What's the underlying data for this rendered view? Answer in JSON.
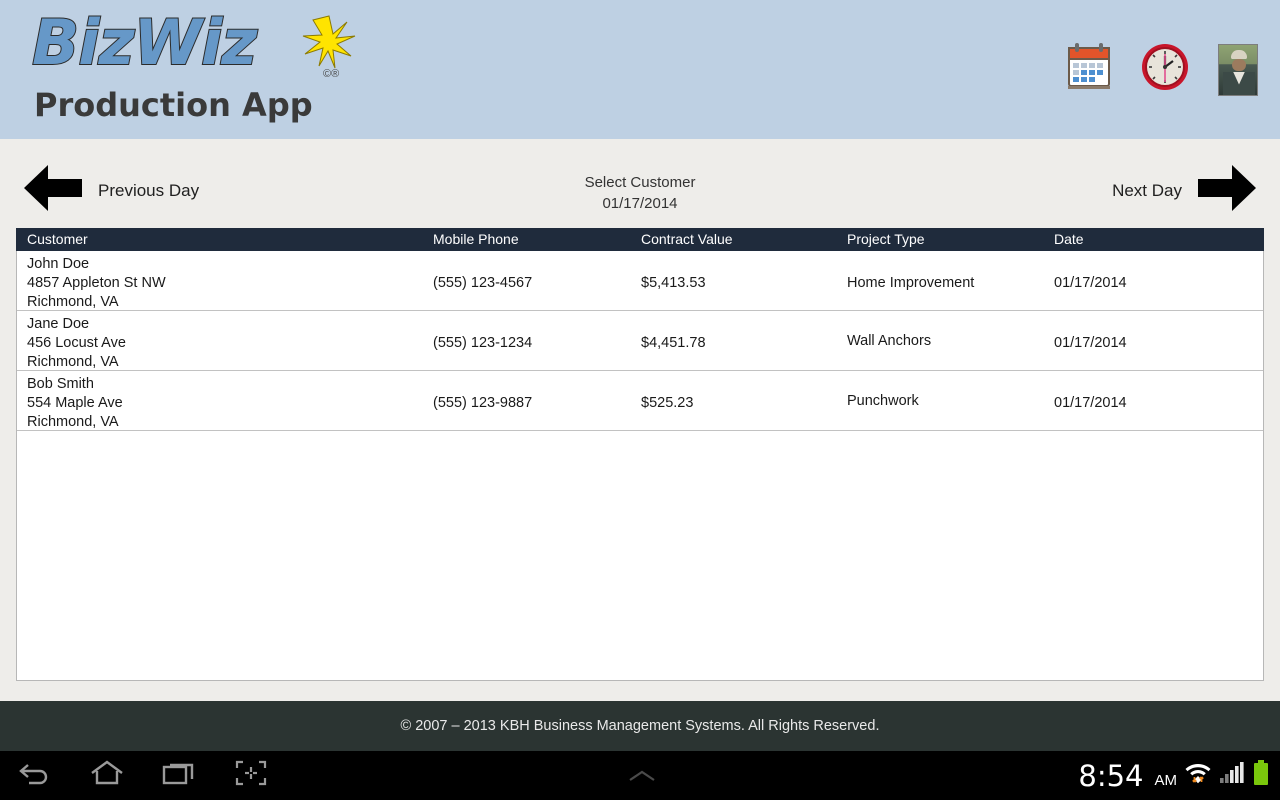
{
  "app": {
    "logo_main": "BizWiz",
    "logo_copyright": "©®",
    "logo_sub": "Production App",
    "header_bg": "#bed0e3",
    "icons": [
      {
        "name": "calendar-icon",
        "label": "Calendar"
      },
      {
        "name": "clock-icon",
        "label": "Clock"
      },
      {
        "name": "user-avatar",
        "label": "User Profile"
      }
    ]
  },
  "daynav": {
    "prev_label": "Previous Day",
    "next_label": "Next Day",
    "title": "Select Customer",
    "date": "01/17/2014"
  },
  "table": {
    "columns": [
      "Customer",
      "Mobile Phone",
      "Contract Value",
      "Project Type",
      "Date"
    ],
    "header_bg": "#1f2b3c",
    "rows": [
      {
        "name": "John Doe",
        "address": "4857 Appleton St NW",
        "city": "Richmond, VA",
        "phone": "(555) 123-4567",
        "value": "$5,413.53",
        "project": "Home Improvement",
        "date": "01/17/2014"
      },
      {
        "name": "Jane Doe",
        "address": "456 Locust Ave",
        "city": "Richmond, VA",
        "phone": "(555) 123-1234",
        "value": "$4,451.78",
        "project": "Wall Anchors",
        "date": "01/17/2014"
      },
      {
        "name": "Bob Smith",
        "address": "554 Maple Ave",
        "city": "Richmond, VA",
        "phone": "(555) 123-9887",
        "value": "$525.23",
        "project": "Punchwork",
        "date": "01/17/2014"
      }
    ]
  },
  "footer": {
    "copyright": "© 2007 – 2013 KBH Business Management Systems. All Rights Reserved."
  },
  "system_bar": {
    "time": "8:54",
    "ampm": "AM",
    "nav": [
      {
        "name": "back-icon"
      },
      {
        "name": "home-icon"
      },
      {
        "name": "recents-icon"
      },
      {
        "name": "screenshot-icon"
      }
    ],
    "status": [
      {
        "name": "wifi-icon"
      },
      {
        "name": "signal-icon"
      },
      {
        "name": "battery-icon"
      }
    ]
  }
}
